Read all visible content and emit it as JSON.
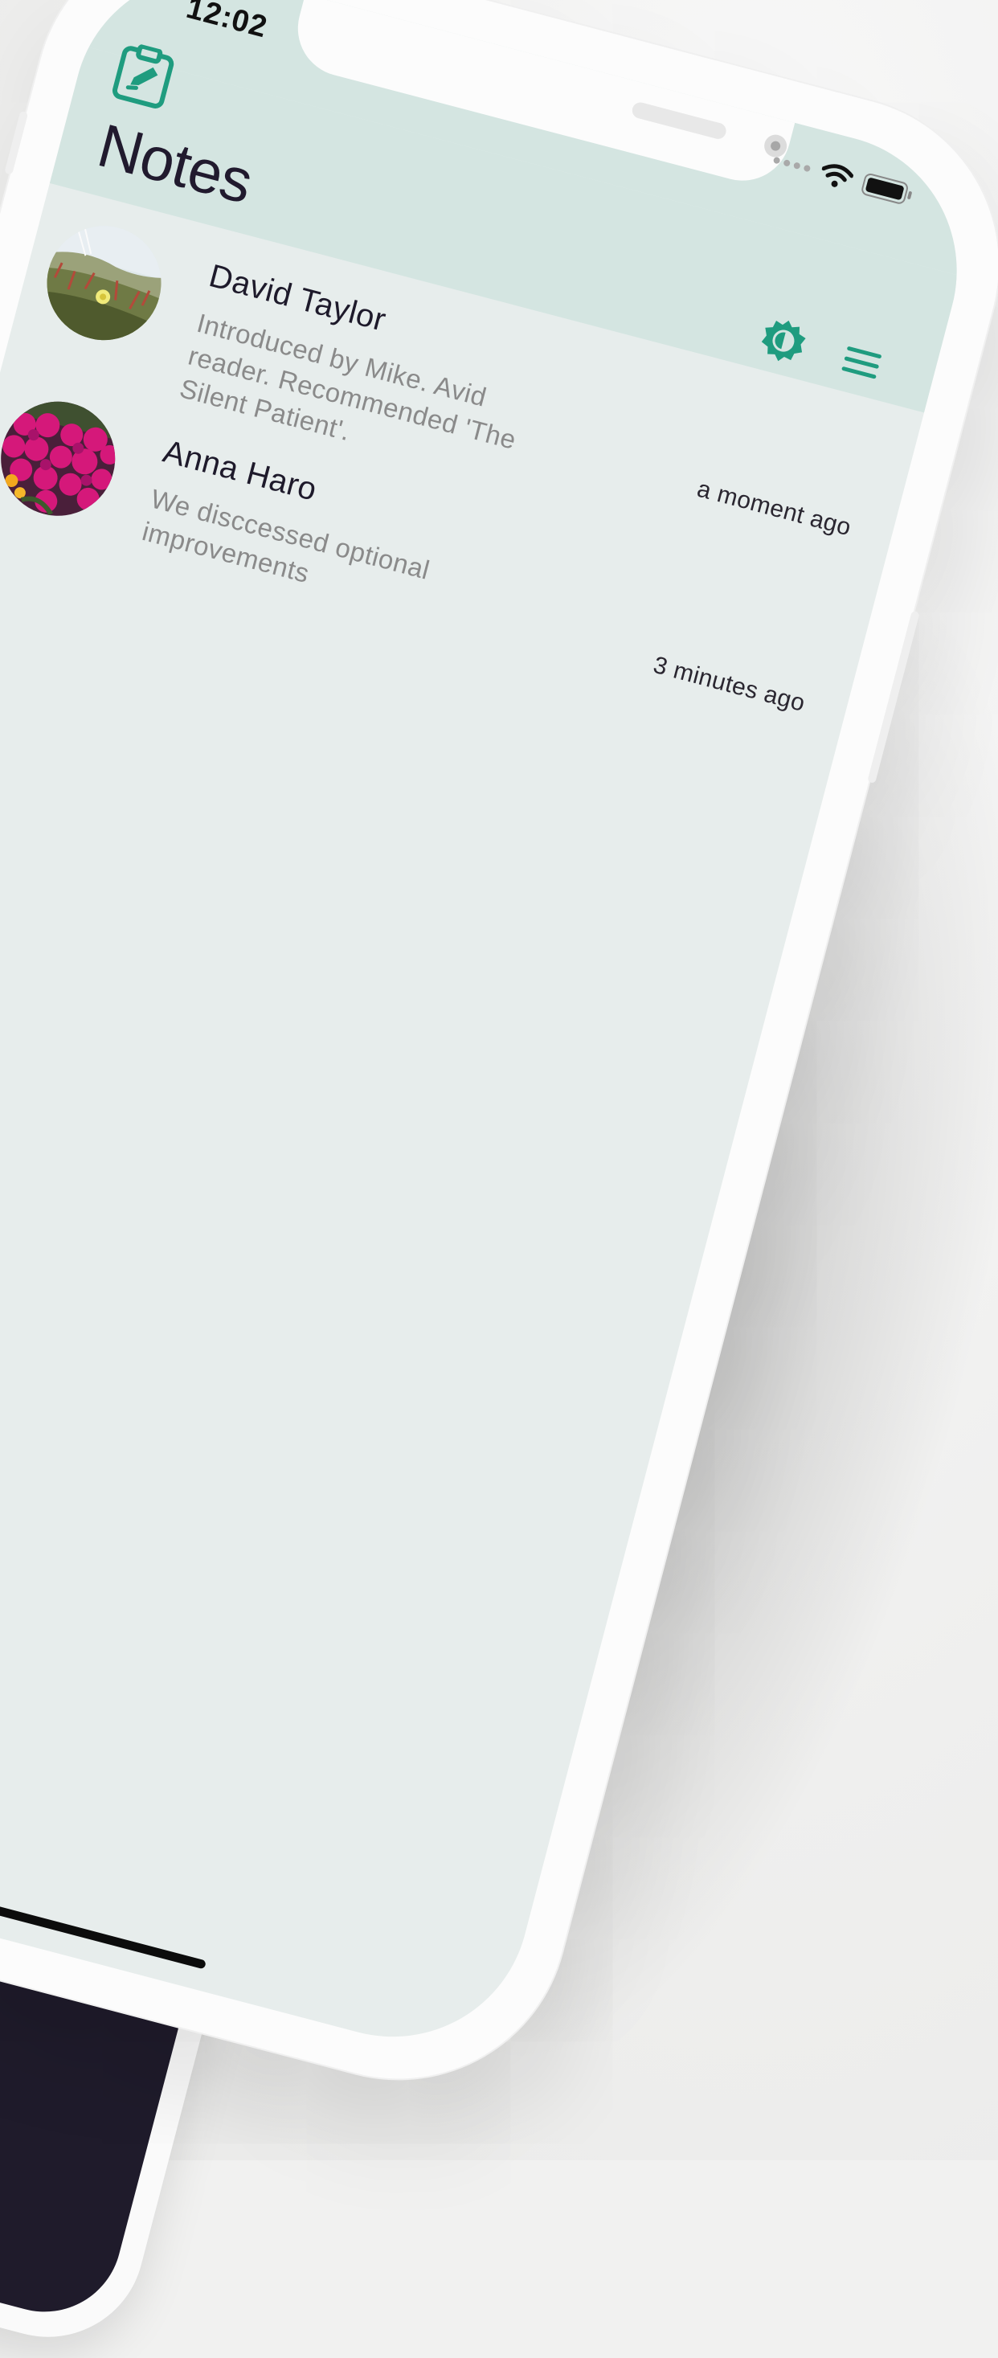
{
  "status_bar": {
    "time": "12:02"
  },
  "header": {
    "title": "Notes",
    "app_icon": "clipboard-edit-icon",
    "theme_icon": "brightness-icon",
    "menu_icon": "menu-icon"
  },
  "notes": [
    {
      "name": "David Taylor",
      "preview": "Introduced by Mike. Avid reader. Recommended 'The Silent Patient'.",
      "time": "a moment ago",
      "avatar": "dune-flower-photo"
    },
    {
      "name": "Anna Haro",
      "preview": "We disccessed optional improvements",
      "time": "3 minutes ago",
      "avatar": "magenta-flowers-photo"
    }
  ],
  "colors": {
    "accent": "#1f9c7f",
    "header_bg": "#d4e5e1",
    "screen_bg": "#e7edec",
    "title_text": "#211a2e"
  }
}
